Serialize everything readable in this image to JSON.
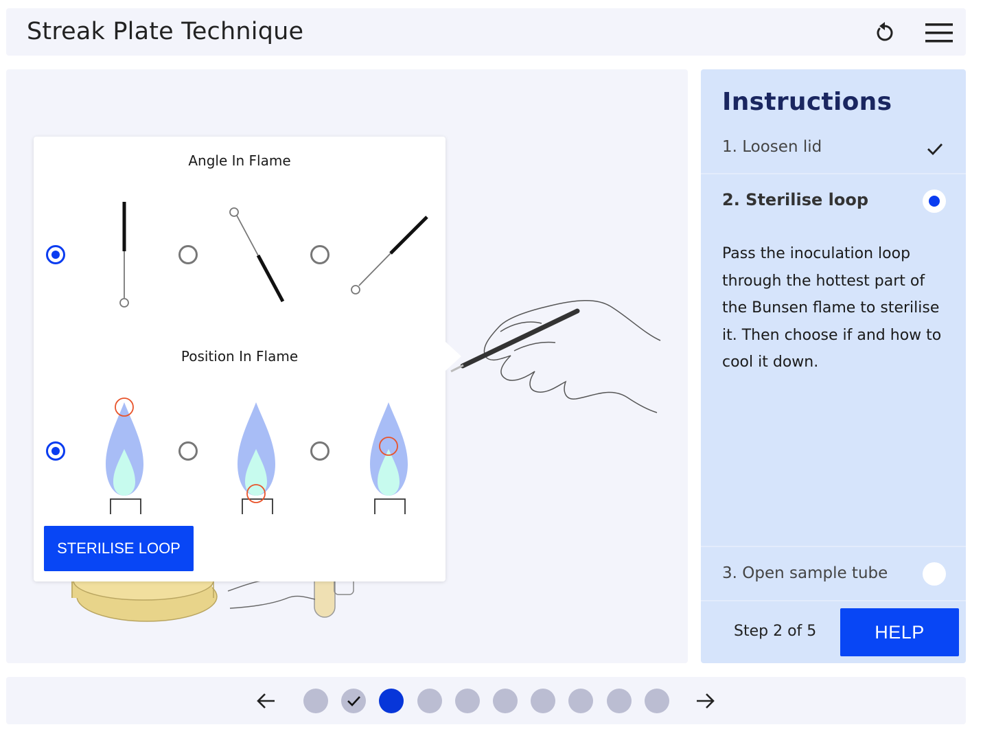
{
  "header": {
    "title": "Streak Plate Technique",
    "reset_icon": "reset-icon",
    "menu_icon": "hamburger-menu-icon"
  },
  "popup": {
    "angle_title": "Angle In Flame",
    "position_title": "Position In Flame",
    "angle_selected_option": 1,
    "position_selected_option": 1,
    "action_label": "STERILISE LOOP"
  },
  "instructions": {
    "title": "Instructions",
    "steps": [
      {
        "label": "1. Loosen lid",
        "status": "done"
      },
      {
        "label": "2. Sterilise loop",
        "status": "current"
      },
      {
        "label": "3. Open sample tube",
        "status": "pending"
      }
    ],
    "current_description": "Pass the inoculation loop through the hottest part of the Bunsen flame to sterilise it. Then choose if and how to cool it down.",
    "step_counter": "Step 2 of 5",
    "help_label": "HELP"
  },
  "navigation": {
    "prev_icon": "arrow-left-icon",
    "next_icon": "arrow-right-icon",
    "dots_total": 10,
    "dot_completed": 2,
    "dot_current": 3
  },
  "colors": {
    "accent": "#0846f5",
    "panel": "#d6e4fb",
    "flame_outer": "#a8bdf6",
    "flame_inner": "#c7fbee",
    "marker": "#e8532a"
  }
}
